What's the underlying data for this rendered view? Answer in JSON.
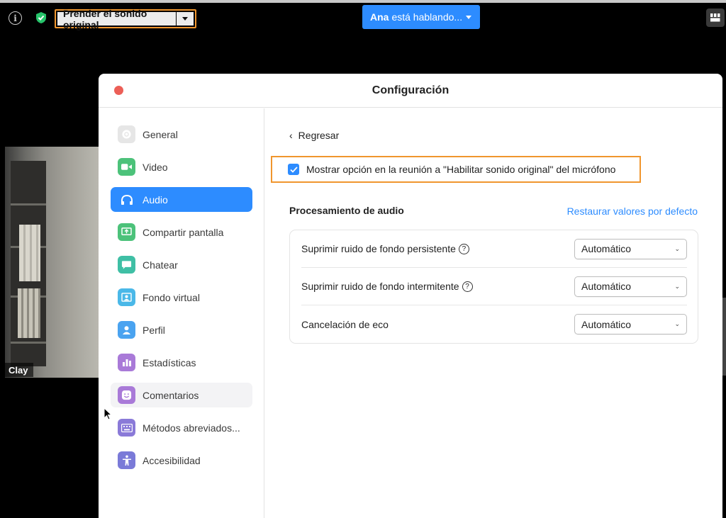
{
  "meeting_bar": {
    "original_sound_label": "Prender el sonido original",
    "speaker_name": "Ana",
    "speaker_suffix": "está hablando...",
    "info_icon": "info-icon",
    "shield_icon": "shield-check-icon",
    "grid_icon": "gallery-view-icon"
  },
  "video": {
    "participant_name": "Clay"
  },
  "settings": {
    "title": "Configuración",
    "sidebar": {
      "items": [
        {
          "label": "General",
          "icon": "gear-icon",
          "color": "#9a9a9a"
        },
        {
          "label": "Video",
          "icon": "video-camera-icon",
          "color": "#4cc27a"
        },
        {
          "label": "Audio",
          "icon": "headphones-icon",
          "color": "#ffffff"
        },
        {
          "label": "Compartir pantalla",
          "icon": "share-screen-icon",
          "color": "#4cc27a"
        },
        {
          "label": "Chatear",
          "icon": "chat-bubble-icon",
          "color": "#3fbfa5"
        },
        {
          "label": "Fondo virtual",
          "icon": "virtual-background-icon",
          "color": "#4ab8e8"
        },
        {
          "label": "Perfil",
          "icon": "profile-icon",
          "color": "#4aa3f0"
        },
        {
          "label": "Estadísticas",
          "icon": "statistics-icon",
          "color": "#a97ad8"
        },
        {
          "label": "Comentarios",
          "icon": "feedback-smile-icon",
          "color": "#a97ad8"
        },
        {
          "label": "Métodos abreviados...",
          "icon": "keyboard-icon",
          "color": "#8a7ad8"
        },
        {
          "label": "Accesibilidad",
          "icon": "accessibility-icon",
          "color": "#7a7ad8"
        }
      ],
      "active_label": "Audio"
    },
    "audio": {
      "back_label": "Regresar",
      "original_sound_option": "Mostrar opción en la reunión a \"Habilitar sonido original\" del micrófono",
      "original_sound_checked": true,
      "section_title": "Procesamiento de audio",
      "restore_label": "Restaurar valores por defecto",
      "rows": [
        {
          "label": "Suprimir ruido de fondo persistente",
          "value": "Automático",
          "help": true
        },
        {
          "label": "Suprimir ruido de fondo intermitente",
          "value": "Automático",
          "help": true
        },
        {
          "label": "Cancelación de eco",
          "value": "Automático",
          "help": false
        }
      ]
    }
  },
  "colors": {
    "accent": "#2d8cff",
    "highlight_border": "#f0962e",
    "close": "#ec5f57"
  }
}
